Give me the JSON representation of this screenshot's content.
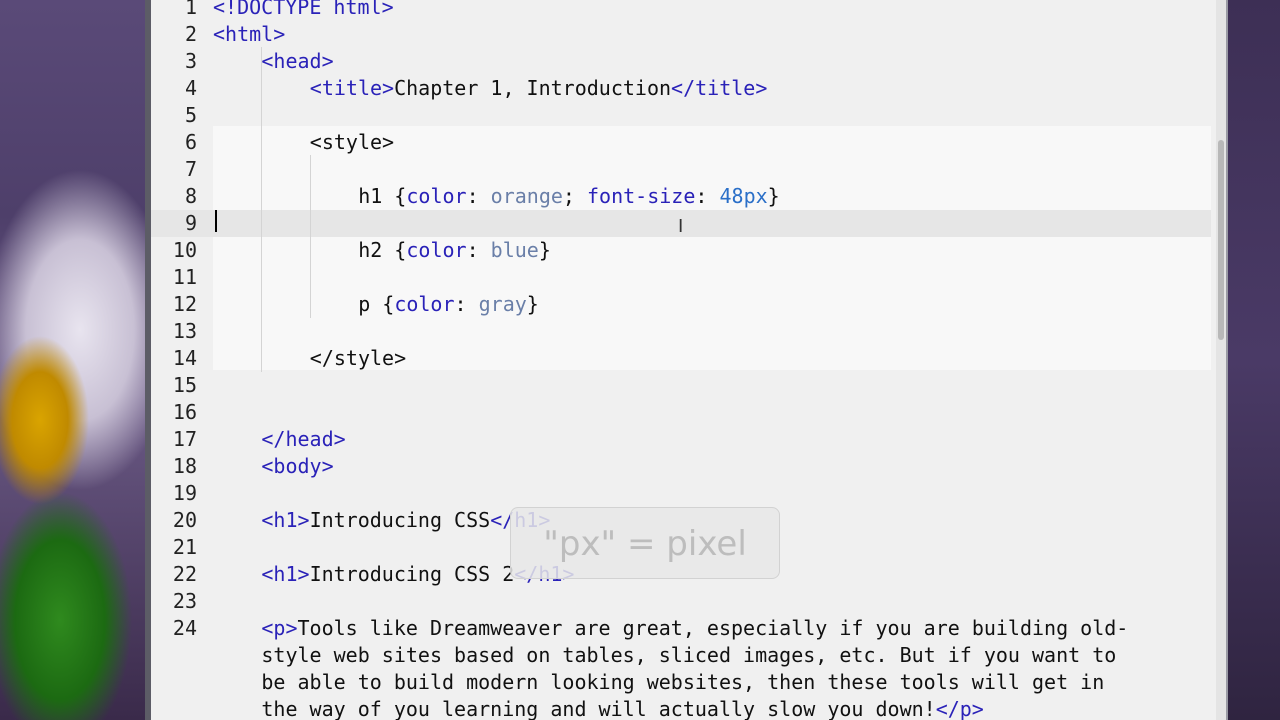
{
  "editor": {
    "lines": [
      {
        "n": "1",
        "segments": [
          {
            "t": "tag",
            "v": "<!DOCTYPE html>"
          }
        ]
      },
      {
        "n": "2",
        "segments": [
          {
            "t": "tag",
            "v": "<html>"
          }
        ]
      },
      {
        "n": "3",
        "segments": [
          {
            "t": "tag",
            "v": "<head>"
          }
        ]
      },
      {
        "n": "4",
        "segments": [
          {
            "t": "tag",
            "v": "<title>"
          },
          {
            "t": "txt",
            "v": "Chapter 1, Introduction"
          },
          {
            "t": "tag",
            "v": "</title>"
          }
        ]
      },
      {
        "n": "5",
        "segments": []
      },
      {
        "n": "6",
        "segments": [
          {
            "t": "txt",
            "v": "<style>"
          }
        ]
      },
      {
        "n": "7",
        "segments": []
      },
      {
        "n": "8",
        "segments": [
          {
            "t": "txt",
            "v": "h1 {"
          },
          {
            "t": "prop",
            "v": "color"
          },
          {
            "t": "txt",
            "v": ": "
          },
          {
            "t": "val",
            "v": "orange"
          },
          {
            "t": "txt",
            "v": "; "
          },
          {
            "t": "prop",
            "v": "font-size"
          },
          {
            "t": "txt",
            "v": ": "
          },
          {
            "t": "num",
            "v": "48px"
          },
          {
            "t": "txt",
            "v": "}"
          }
        ]
      },
      {
        "n": "9",
        "segments": []
      },
      {
        "n": "10",
        "segments": [
          {
            "t": "txt",
            "v": "h2 {"
          },
          {
            "t": "prop",
            "v": "color"
          },
          {
            "t": "txt",
            "v": ": "
          },
          {
            "t": "val",
            "v": "blue"
          },
          {
            "t": "txt",
            "v": "}"
          }
        ]
      },
      {
        "n": "11",
        "segments": []
      },
      {
        "n": "12",
        "segments": [
          {
            "t": "txt",
            "v": "p {"
          },
          {
            "t": "prop",
            "v": "color"
          },
          {
            "t": "txt",
            "v": ": "
          },
          {
            "t": "val",
            "v": "gray"
          },
          {
            "t": "txt",
            "v": "}"
          }
        ]
      },
      {
        "n": "13",
        "segments": []
      },
      {
        "n": "14",
        "segments": [
          {
            "t": "txt",
            "v": "</style>"
          }
        ]
      },
      {
        "n": "15",
        "segments": []
      },
      {
        "n": "16",
        "segments": []
      },
      {
        "n": "17",
        "segments": [
          {
            "t": "tag",
            "v": "</head>"
          }
        ]
      },
      {
        "n": "18",
        "segments": [
          {
            "t": "tag",
            "v": "<body>"
          }
        ]
      },
      {
        "n": "19",
        "segments": []
      },
      {
        "n": "20",
        "segments": [
          {
            "t": "tag",
            "v": "<h1>"
          },
          {
            "t": "txt",
            "v": "Introducing CSS"
          },
          {
            "t": "tag",
            "v": "</h1>"
          }
        ]
      },
      {
        "n": "21",
        "segments": []
      },
      {
        "n": "22",
        "segments": [
          {
            "t": "tag",
            "v": "<h1>"
          },
          {
            "t": "txt",
            "v": "Introducing CSS 2"
          },
          {
            "t": "tag",
            "v": "</h1>"
          }
        ]
      },
      {
        "n": "23",
        "segments": []
      },
      {
        "n": "24",
        "segments": [
          {
            "t": "tag",
            "v": "<p>"
          },
          {
            "t": "txt",
            "v": "Tools like Dreamweaver are great, especially if you are building old-"
          }
        ]
      },
      {
        "n": "",
        "segments": [
          {
            "t": "txt",
            "v": "style web sites based on tables, sliced images, etc. But if you want to"
          }
        ]
      },
      {
        "n": "",
        "segments": [
          {
            "t": "txt",
            "v": "be able to build modern looking websites, then these tools will get in"
          }
        ]
      },
      {
        "n": "",
        "segments": [
          {
            "t": "txt",
            "v": "the way of you learning and will actually slow you down!"
          },
          {
            "t": "tag",
            "v": "</p>"
          }
        ]
      }
    ],
    "current_line": "9"
  },
  "tooltip": {
    "text": "\"px\" = pixel"
  },
  "colors": {
    "tag": "#2a22b8",
    "property": "#2a22b8",
    "value": "#6a7fa8",
    "number": "#2a6fc8",
    "text": "#111111"
  }
}
